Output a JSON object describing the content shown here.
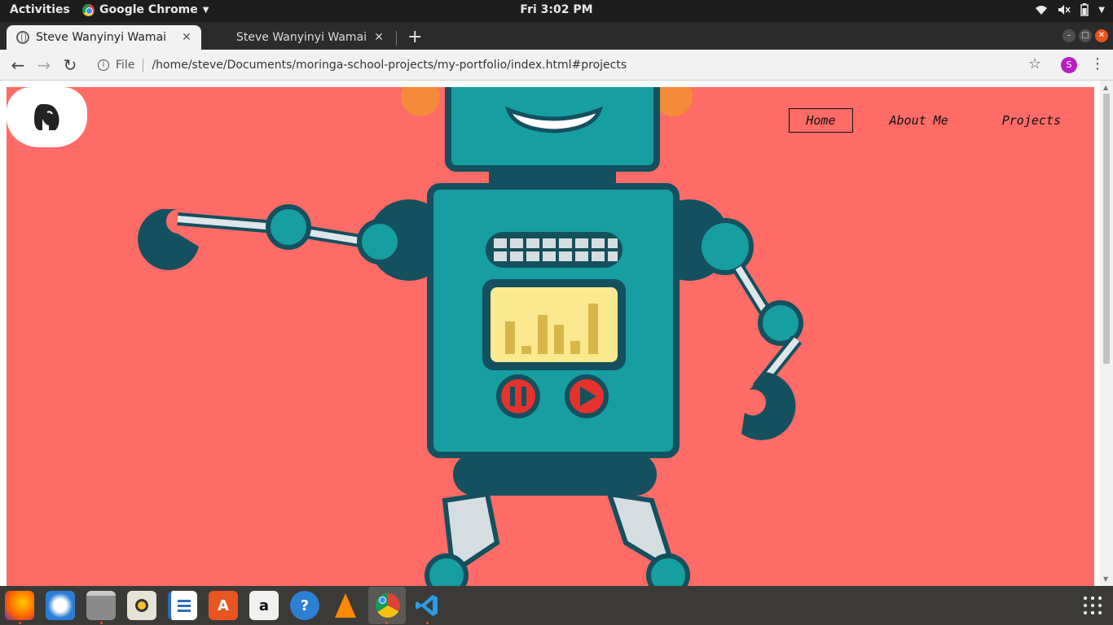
{
  "topbar": {
    "activities": "Activities",
    "app_name": "Google Chrome",
    "clock": "Fri  3:02 PM"
  },
  "tabs": [
    {
      "title": "Steve Wanyinyi Wamai",
      "active": true
    },
    {
      "title": "Steve Wanyinyi Wamai",
      "active": false
    }
  ],
  "addressbar": {
    "scheme_label": "File",
    "url": "/home/steve/Documents/moringa-school-projects/my-portfolio/index.html#projects",
    "profile_initial": "S"
  },
  "page": {
    "nav": [
      {
        "label": "Home",
        "active": true
      },
      {
        "label": "About Me",
        "active": false
      },
      {
        "label": "Projects",
        "active": false
      }
    ],
    "hero_bg": "#ff6b66"
  },
  "dock": {
    "apps": [
      "firefox-icon",
      "thunderbird-icon",
      "files-icon",
      "rhythmbox-icon",
      "writer-icon",
      "software-center-icon",
      "amazon-icon",
      "help-icon",
      "vlc-icon",
      "chrome-icon",
      "vscode-icon"
    ],
    "accent": "#e95420"
  }
}
